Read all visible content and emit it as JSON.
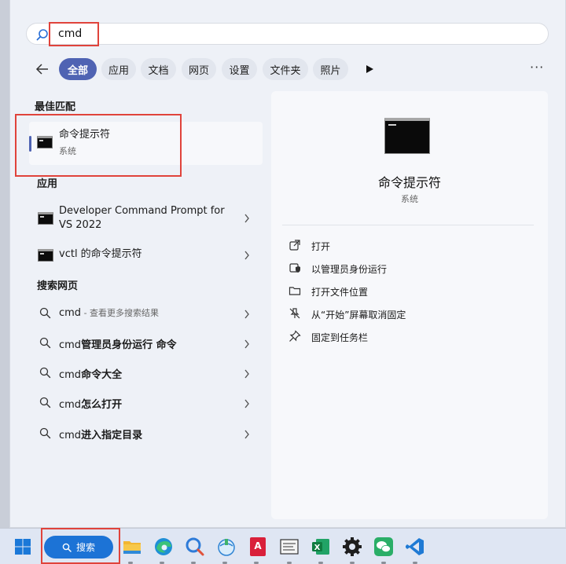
{
  "search": {
    "value": "cmd"
  },
  "filters": {
    "all": "全部",
    "apps": "应用",
    "documents": "文档",
    "web": "网页",
    "settings": "设置",
    "folders": "文件夹",
    "photos": "照片",
    "more": "···"
  },
  "best_match": {
    "heading": "最佳匹配",
    "title": "命令提示符",
    "subtitle": "系统"
  },
  "apps": {
    "heading": "应用",
    "items": [
      {
        "line1": "Developer Command Prompt for",
        "line2": "VS 2022"
      },
      {
        "line1": "vctl 的命令提示符"
      }
    ]
  },
  "web": {
    "heading": "搜索网页",
    "items": [
      {
        "prefix": "cmd",
        "hint": " - 查看更多搜索结果",
        "suffix": ""
      },
      {
        "prefix": "cmd",
        "hint": "",
        "suffix": "管理员身份运行 命令"
      },
      {
        "prefix": "cmd",
        "hint": "",
        "suffix": "命令大全"
      },
      {
        "prefix": "cmd",
        "hint": "",
        "suffix": "怎么打开"
      },
      {
        "prefix": "cmd",
        "hint": "",
        "suffix": "进入指定目录"
      }
    ]
  },
  "details": {
    "title": "命令提示符",
    "subtitle": "系统",
    "actions": [
      "打开",
      "以管理员身份运行",
      "打开文件位置",
      "从“开始”屏幕取消固定",
      "固定到任务栏"
    ]
  },
  "taskbar": {
    "search_label": "搜索",
    "icons": [
      "windows-start-icon",
      "file-explorer-icon",
      "edge-browser-icon",
      "search-app-icon",
      "network-app-icon",
      "autocad-icon",
      "notepad-app-icon",
      "excel-icon",
      "settings-gear-icon",
      "wechat-icon",
      "vs-code-icon"
    ]
  },
  "colors": {
    "accent": "#4f63b3",
    "highlight_red": "#e0433b",
    "taskbar_search": "#1c73d6"
  }
}
